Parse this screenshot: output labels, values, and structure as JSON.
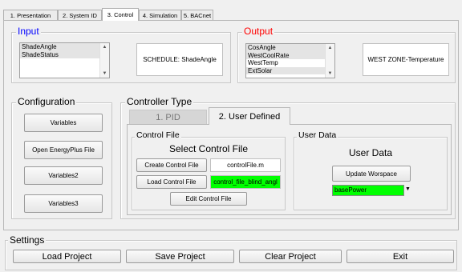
{
  "tabs": [
    {
      "label": "1. Presentation"
    },
    {
      "label": "2. System ID"
    },
    {
      "label": "3. Control"
    },
    {
      "label": "4. Simulation"
    },
    {
      "label": "5. BACnet"
    }
  ],
  "input": {
    "title": "Input",
    "items": [
      "ShadeAngle",
      "ShadeStatus"
    ],
    "display": "SCHEDULE: ShadeAngle"
  },
  "output": {
    "title": "Output",
    "items": [
      "CosAngle",
      "WestCoolRate",
      "WestTemp",
      "ExtSolar"
    ],
    "display": "WEST ZONE-Temperature"
  },
  "configuration": {
    "title": "Configuration",
    "buttons": [
      "Variables",
      "Open EnergyPlus File",
      "Variables2",
      "Variables3"
    ]
  },
  "controller_type": {
    "title": "Controller Type",
    "tabs": [
      "1. PID",
      "2. User Defined"
    ]
  },
  "control_file": {
    "title": "Control File",
    "heading": "Select Control File",
    "create_label": "Create Control File",
    "create_value": "controlFile.m",
    "load_label": "Load Control File",
    "load_value": "control_file_blind_angl",
    "edit_label": "Edit Control File"
  },
  "user_data": {
    "title": "User Data",
    "heading": "User Data",
    "update_label": "Update Worspace",
    "dropdown_value": "basePower"
  },
  "settings": {
    "title": "Settings",
    "buttons": [
      "Load Project",
      "Save Project",
      "Clear Project",
      "Exit"
    ]
  },
  "colors": {
    "input_title": "#0000ff",
    "output_title": "#ff0000",
    "highlight_green": "#00ff00"
  }
}
